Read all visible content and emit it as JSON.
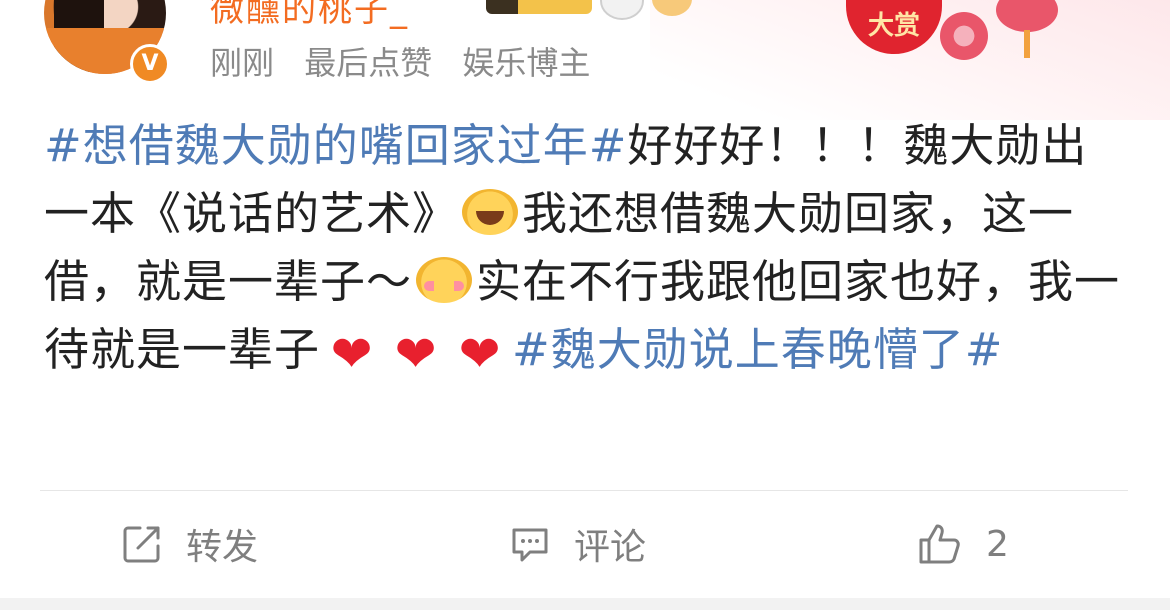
{
  "header": {
    "username": "微醺的桃子_",
    "meta_time": "刚刚",
    "meta_last_like": "最后点赞",
    "meta_role": "娱乐博主",
    "verified_icon": "verified-v-icon",
    "reward_label": "大赏"
  },
  "post": {
    "segments": [
      {
        "type": "hashtag",
        "text": "#想借魏大勋的嘴回家过年#"
      },
      {
        "type": "text",
        "text": "好好好！！！魏大勋出一本《说话的艺术》"
      },
      {
        "type": "emoji",
        "name": "laughing-tears-emoji"
      },
      {
        "type": "text",
        "text": "我还想借魏大勋回家，这一借，就是一辈子～"
      },
      {
        "type": "emoji",
        "name": "shy-blush-emoji"
      },
      {
        "type": "text",
        "text": "实在不行我跟他回家也好，我一待就是一辈子"
      },
      {
        "type": "emoji",
        "name": "red-heart-emoji"
      },
      {
        "type": "emoji",
        "name": "red-heart-emoji"
      },
      {
        "type": "emoji",
        "name": "red-heart-emoji"
      },
      {
        "type": "hashtag",
        "text": "#魏大勋说上春晚懵了#"
      }
    ]
  },
  "actions": {
    "repost_label": "转发",
    "comment_label": "评论",
    "like_count": "2"
  },
  "colors": {
    "hashtag": "#4f7bb6",
    "username": "#f36c21",
    "meta": "#8a8a8a",
    "action": "#7f7f7f"
  }
}
